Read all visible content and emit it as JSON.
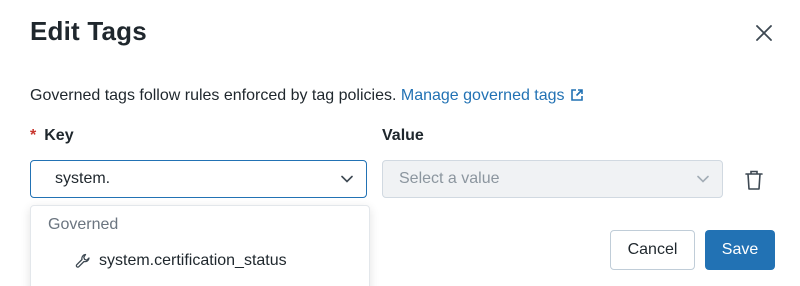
{
  "dialog": {
    "title": "Edit Tags",
    "close_icon": "close-icon"
  },
  "description": {
    "text": "Governed tags follow rules enforced by tag policies. ",
    "link_label": "Manage governed tags",
    "link_icon": "external-link-icon"
  },
  "form": {
    "key_required_marker": "*",
    "key_label": "Key",
    "value_label": "Value",
    "key_input_value": "system.",
    "value_placeholder": "Select a value",
    "delete_icon": "trash-icon"
  },
  "dropdown": {
    "group_label": "Governed",
    "options": [
      {
        "label": "system.certification_status",
        "icon": "wrench-icon"
      }
    ]
  },
  "footer": {
    "cancel_label": "Cancel",
    "save_label": "Save"
  },
  "colors": {
    "accent": "#2272b4",
    "required": "#c8352d",
    "disabled_bg": "#f0f2f4",
    "text": "#1f272d"
  }
}
